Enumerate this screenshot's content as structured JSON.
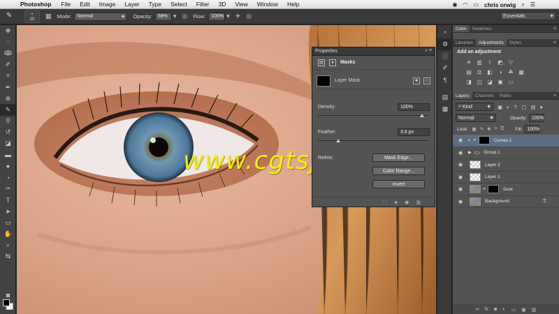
{
  "menubar": {
    "app": "Photoshop",
    "menus": [
      "File",
      "Edit",
      "Image",
      "Layer",
      "Type",
      "Select",
      "Filter",
      "3D",
      "View",
      "Window",
      "Help"
    ],
    "user": "chris orwig"
  },
  "options": {
    "brush_size": "20",
    "mode_label": "Mode:",
    "mode_value": "Normal",
    "opacity_label": "Opacity:",
    "opacity_value": "68%",
    "flow_label": "Flow:",
    "flow_value": "100%",
    "workspace": "Essentials"
  },
  "watermark": "www.cgtsj.com",
  "properties": {
    "title": "Properties",
    "section": "Masks",
    "mask_type": "Layer Mask",
    "density_label": "Density:",
    "density_value": "100%",
    "feather_label": "Feather:",
    "feather_value": "3.6 px",
    "refine_label": "Refine:",
    "buttons": [
      "Mask Edge...",
      "Color Range...",
      "Invert"
    ]
  },
  "right_top_tabs": [
    "Color",
    "Swatches"
  ],
  "adjust_tabs": [
    "Libraries",
    "Adjustments",
    "Styles"
  ],
  "adjust_title": "Add an adjustment",
  "layers_tabs": [
    "Layers",
    "Channels",
    "Paths"
  ],
  "layers": {
    "kind": "Kind",
    "blend": "Normal",
    "opacity_label": "Opacity:",
    "opacity_value": "100%",
    "lock_label": "Lock:",
    "fill_label": "Fill:",
    "fill_value": "100%",
    "items": [
      {
        "name": "Curves 1"
      },
      {
        "name": "Group 1"
      },
      {
        "name": "Layer 2"
      },
      {
        "name": "Layer 1"
      },
      {
        "name": "Dust"
      },
      {
        "name": "Background"
      }
    ]
  }
}
